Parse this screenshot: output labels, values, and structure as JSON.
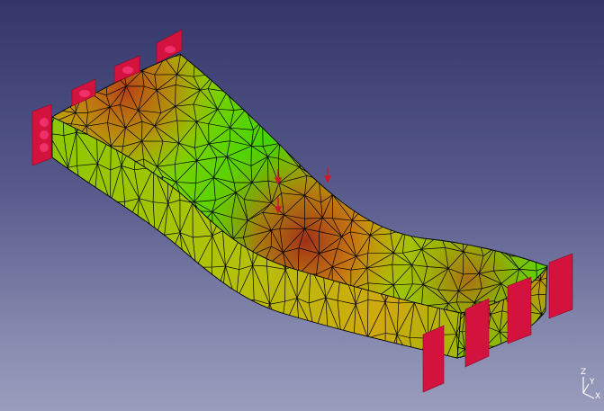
{
  "viewport": {
    "background_top": "#34366a",
    "background_bottom": "#9a9dbc"
  },
  "model": {
    "mesh_color_low": "#2fd200",
    "mesh_color_mid": "#cfd80a",
    "mesh_color_high": "#b5281a",
    "mesh_line_color": "#000000",
    "constraint_color": "#d4123e",
    "load_arrow_color": "#c81a2a"
  },
  "axis": {
    "x_label": "X",
    "y_label": "Y",
    "z_label": "Z"
  }
}
